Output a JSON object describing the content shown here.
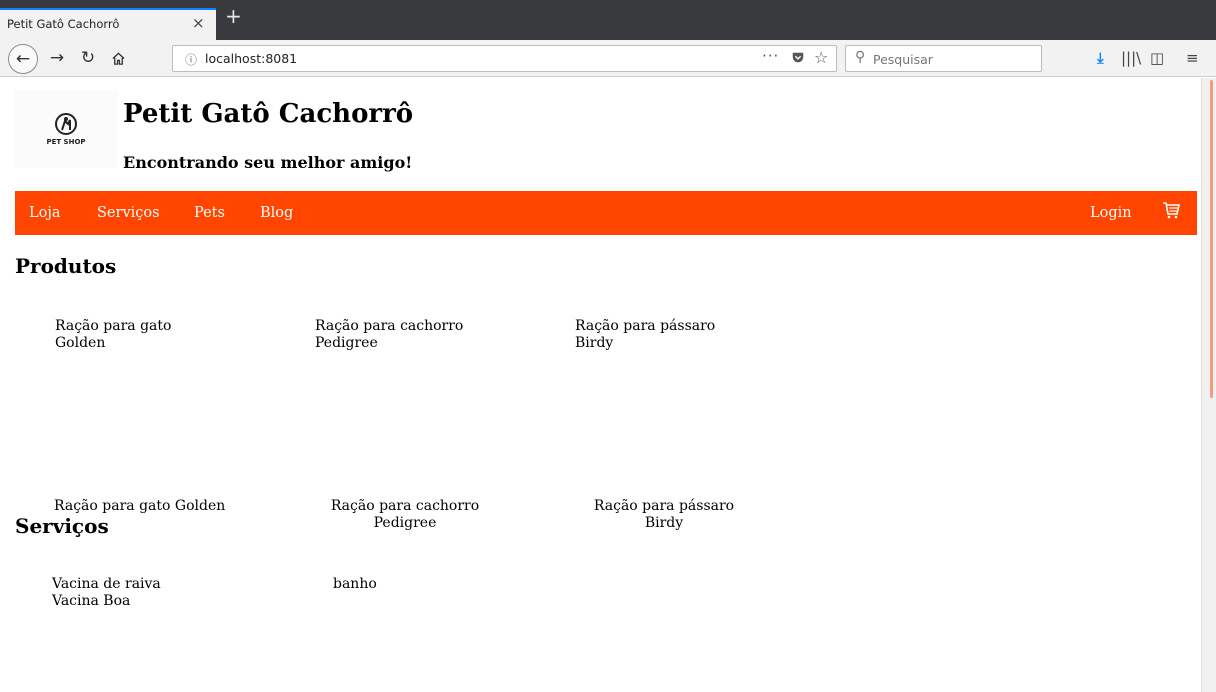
{
  "browser": {
    "tab_title": "Petit Gatô Cachorrô",
    "tab_close": "×",
    "new_tab": "+",
    "url": "localhost:8081",
    "url_more": "···",
    "search_placeholder": "Pesquisar"
  },
  "site": {
    "title": "Petit Gatô Cachorrô",
    "subtitle": "Encontrando seu melhor amigo!",
    "logo_text": "PET SHOP",
    "accent_color": "#ff4500"
  },
  "menu": {
    "items": [
      "Loja",
      "Serviços",
      "Pets",
      "Blog"
    ],
    "login": "Login"
  },
  "produtos": {
    "title": "Produtos",
    "items": [
      {
        "name": "Ração para gato",
        "brand": "Golden"
      },
      {
        "name": "Ração para cachorro",
        "brand": "Pedigree"
      },
      {
        "name": "Ração para pássaro",
        "brand": "Birdy"
      }
    ],
    "captions": [
      {
        "line1": "Ração para gato Golden",
        "line2": ""
      },
      {
        "line1": "Ração para cachorro",
        "line2": "Pedigree"
      },
      {
        "line1": "Ração para pássaro",
        "line2": "Birdy"
      }
    ]
  },
  "servicos": {
    "title": "Serviços",
    "items": [
      {
        "name": "Vacina de raiva",
        "detail": "Vacina Boa"
      },
      {
        "name": "banho",
        "detail": ""
      }
    ]
  }
}
